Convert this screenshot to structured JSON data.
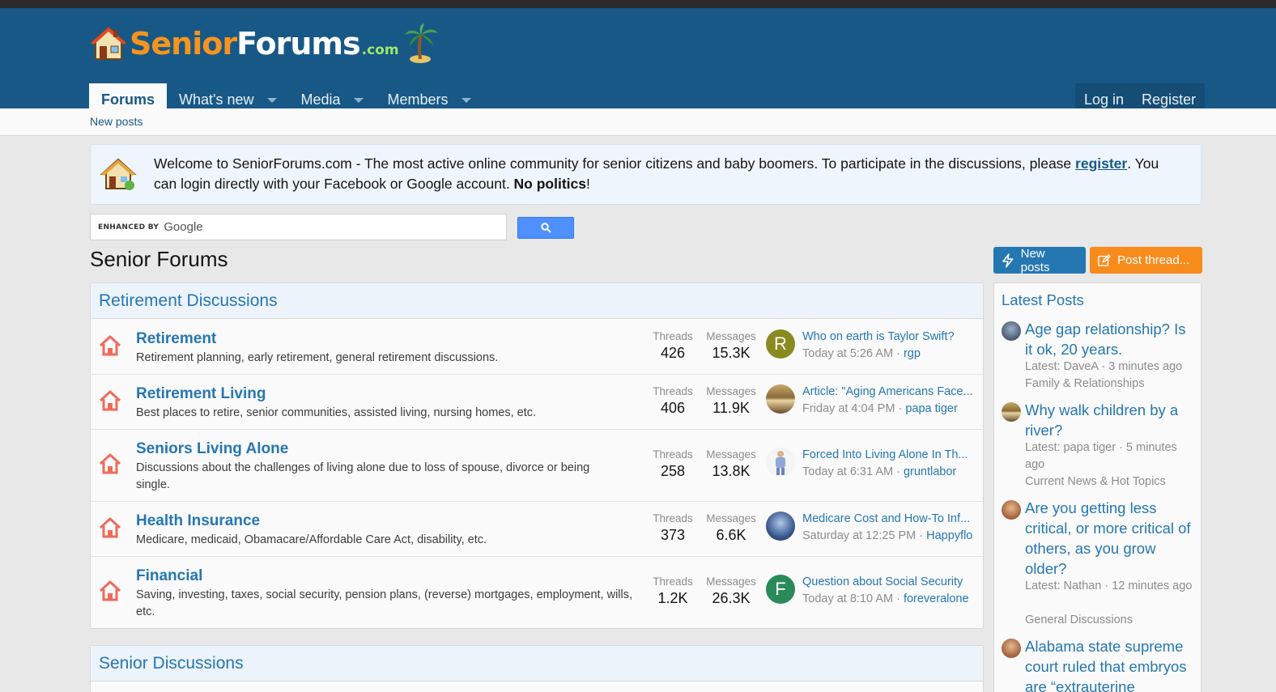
{
  "logo": {
    "senior": "Senior",
    "forums": "Forums",
    "dotcom": ".com"
  },
  "nav": {
    "tabs": [
      {
        "label": "Forums"
      },
      {
        "label": "What's new"
      },
      {
        "label": "Media"
      },
      {
        "label": "Members"
      }
    ],
    "login": "Log in",
    "register": "Register"
  },
  "subnav": {
    "new_posts": "New posts"
  },
  "notice": {
    "text_before": "Welcome to SeniorForums.com - The most active online community for senior citizens and baby boomers. To participate in the discussions, please ",
    "link": "register",
    "text_middle": ". You can login directly with your Facebook or Google account. ",
    "bold": "No politics",
    "text_after": "!"
  },
  "search": {
    "enhanced_by": "ENHANCED BY",
    "google": "Google"
  },
  "page_title": "Senior Forums",
  "buttons": {
    "new_posts": "New posts",
    "post_thread": "Post thread..."
  },
  "colors": {
    "header": "#185886",
    "accent": "#2577b1",
    "orange": "#f78c1d",
    "link": "#2577b1"
  },
  "categories": [
    {
      "title": "Retirement Discussions",
      "stat_labels": {
        "threads": "Threads",
        "messages": "Messages"
      },
      "nodes": [
        {
          "title": "Retirement",
          "desc": "Retirement planning, early retirement, general retirement discussions.",
          "threads": "426",
          "messages": "15.3K",
          "avatar_letter": "R",
          "last_title": "Who on earth is Taylor Swift?",
          "last_time": "Today at 5:26 AM",
          "last_user": "rgp"
        },
        {
          "title": "Retirement Living",
          "desc": "Best places to retire, senior communities, assisted living, nursing homes, etc.",
          "threads": "406",
          "messages": "11.9K",
          "avatar_letter": "",
          "last_title": "Article: \"Aging Americans Face...",
          "last_time": "Friday at 4:04 PM",
          "last_user": "papa tiger"
        },
        {
          "title": "Seniors Living Alone",
          "desc": "Discussions about the challenges of living alone due to loss of spouse, divorce or being single.",
          "threads": "258",
          "messages": "13.8K",
          "avatar_letter": "",
          "last_title": "Forced Into Living Alone In Th...",
          "last_time": "Today at 6:31 AM",
          "last_user": "gruntlabor"
        },
        {
          "title": "Health Insurance",
          "desc": "Medicare, medicaid, Obamacare/Affordable Care Act, disability, etc.",
          "threads": "373",
          "messages": "6.6K",
          "avatar_letter": "",
          "last_title": "Medicare Cost and How-To Inf...",
          "last_time": "Saturday at 12:25 PM",
          "last_user": "Happyflo"
        },
        {
          "title": "Financial",
          "desc": "Saving, investing, taxes, social security, pension plans, (reverse) mortgages, employment, wills, etc.",
          "threads": "1.2K",
          "messages": "26.3K",
          "avatar_letter": "F",
          "last_title": "Question about Social Security",
          "last_time": "Today at 8:10 AM",
          "last_user": "foreveralone"
        }
      ]
    },
    {
      "title": "Senior Discussions"
    }
  ],
  "sidebar": {
    "title": "Latest Posts",
    "posts": [
      {
        "title": "Age gap relationship? Is it ok, 20 years.",
        "meta": "Latest: DaveA · 3 minutes ago",
        "forum": "Family & Relationships"
      },
      {
        "title": "Why walk children by a river?",
        "meta": "Latest: papa tiger · 5 minutes ago",
        "forum": "Current News & Hot Topics"
      },
      {
        "title": "Are you getting less critical, or more critical of others, as you grow older?",
        "meta": "Latest: Nathan · 12 minutes ago",
        "forum": "General Discussions"
      },
      {
        "title": "Alabama state supreme court ruled that embryos are “extrauterine",
        "meta": "",
        "forum": ""
      }
    ]
  },
  "icons": {
    "forum_node": "house-icon",
    "search": "search-icon",
    "new_posts": "bolt-icon",
    "post_thread": "edit-icon"
  }
}
